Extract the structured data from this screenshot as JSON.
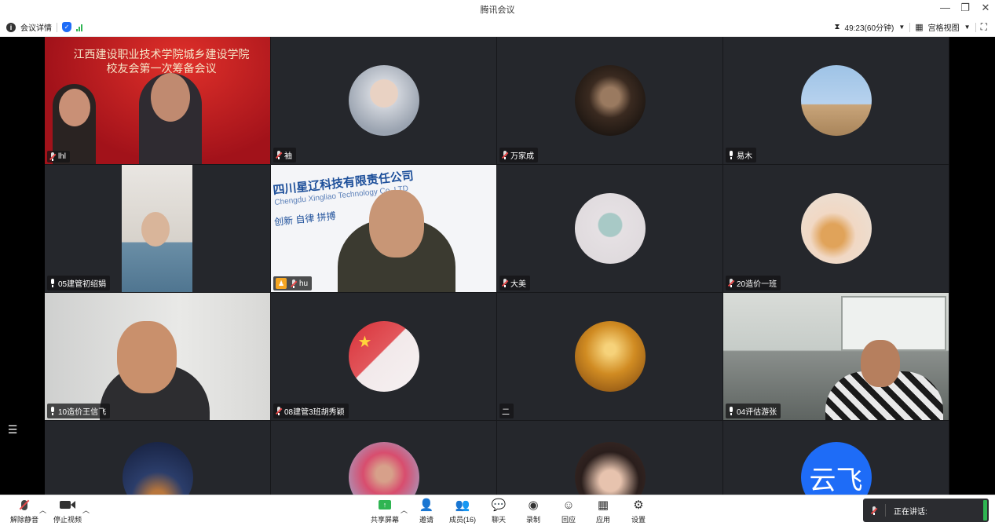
{
  "window": {
    "title": "腾讯会议",
    "minimize": "—",
    "restore": "❐",
    "close": "✕"
  },
  "infobar": {
    "meeting_details": "会议详情",
    "timer": "49:23(60分钟)",
    "view_label": "宫格视图"
  },
  "participants": [
    {
      "name": "lhl",
      "mic": "muted"
    },
    {
      "name": "袖",
      "mic": "muted"
    },
    {
      "name": "万家成",
      "mic": "muted"
    },
    {
      "name": "易木",
      "mic": "on"
    },
    {
      "name": "05建管初绍娟",
      "mic": "on"
    },
    {
      "name": "hu",
      "mic": "muted",
      "host": true
    },
    {
      "name": "大美",
      "mic": "muted"
    },
    {
      "name": "20造价一班",
      "mic": "muted"
    },
    {
      "name": "10造价王信飞",
      "mic": "on"
    },
    {
      "name": "08建管3班胡秀颖",
      "mic": "muted"
    },
    {
      "name": "二",
      "mic": "none"
    },
    {
      "name": "04评估游张",
      "mic": "on"
    },
    {
      "name": "",
      "mic": "none"
    },
    {
      "name": "",
      "mic": "none"
    },
    {
      "name": "",
      "mic": "none"
    },
    {
      "name": "",
      "mic": "none"
    }
  ],
  "banner_text": {
    "line1": "江西建设职业技术学院城乡建设学院",
    "line2": "校友会第一次筹备会议",
    "company": "四川星辽科技有限责任公司",
    "company_en": "Chengdu Xingliao Technology Co.,LTD",
    "slogan": "创新 自律 拼搏"
  },
  "avatar_text_yunfei": "云飞",
  "toolbar": {
    "unmute": "解除静音",
    "stop_video": "停止视频",
    "share_screen": "共享屏幕",
    "invite": "邀请",
    "members": "成员(16)",
    "chat": "聊天",
    "record": "录制",
    "react": "回应",
    "apps": "应用",
    "settings": "设置"
  },
  "speaking": {
    "label": "正在讲话:"
  },
  "colors": {
    "accent_blue": "#1e6cf7",
    "signal_green": "#2fb552",
    "tile_bg": "#25272c",
    "muted_red": "#e84a4a",
    "host_orange": "#f5a623"
  }
}
